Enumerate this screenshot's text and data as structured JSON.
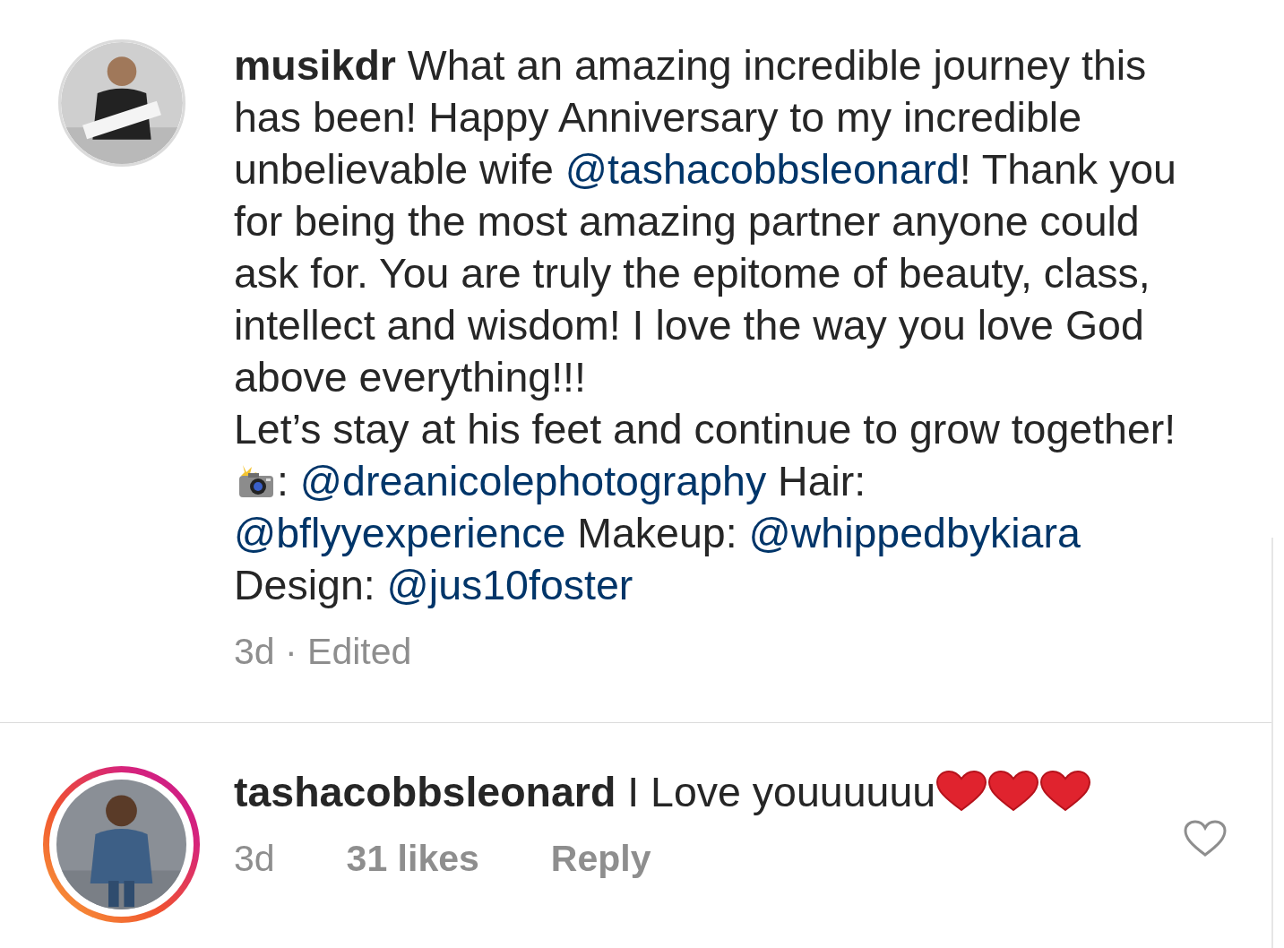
{
  "comments": [
    {
      "story_ring": false,
      "username": "musikdr",
      "body": [
        {
          "kind": "text",
          "text": "What an amazing incredible journey this has been! Happy Anniversary to my incredible unbelievable wife "
        },
        {
          "kind": "mention",
          "text": "@tashacobbsleonard"
        },
        {
          "kind": "text",
          "text": "! Thank you for being the most amazing partner anyone could ask for. You are truly the epitome of beauty, class, intellect and wisdom! I love the way you love God above everything!!!\nLet’s stay at his feet and continue to grow together! "
        },
        {
          "kind": "camera"
        },
        {
          "kind": "text",
          "text": ": "
        },
        {
          "kind": "mention",
          "text": "@dreanicolephotography"
        },
        {
          "kind": "text",
          "text": " Hair: "
        },
        {
          "kind": "mention",
          "text": "@bflyyexperience"
        },
        {
          "kind": "text",
          "text": " Makeup: "
        },
        {
          "kind": "mention",
          "text": "@whippedbykiara"
        },
        {
          "kind": "text",
          "text": " Design: "
        },
        {
          "kind": "mention",
          "text": "@jus10foster"
        }
      ],
      "meta": [
        {
          "kind": "plain",
          "text": "3d · Edited"
        }
      ]
    },
    {
      "story_ring": true,
      "username": "tashacobbsleonard",
      "body": [
        {
          "kind": "text",
          "text": "I Love youuuuuu"
        },
        {
          "kind": "heart"
        },
        {
          "kind": "heart"
        },
        {
          "kind": "heart"
        }
      ],
      "meta": [
        {
          "kind": "plain",
          "text": "3d"
        },
        {
          "kind": "button",
          "text": "31 likes"
        },
        {
          "kind": "button",
          "text": "Reply"
        }
      ],
      "liked": false
    }
  ]
}
